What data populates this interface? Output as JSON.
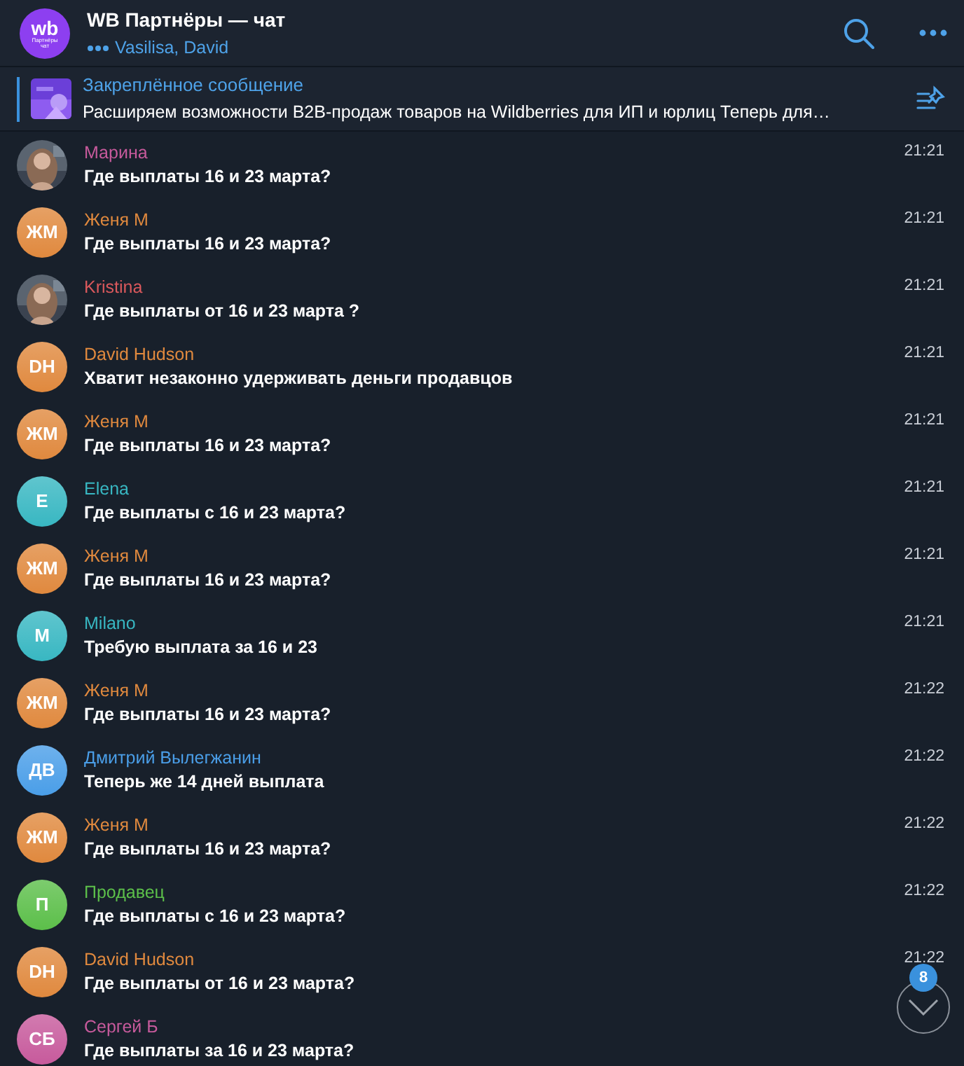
{
  "header": {
    "title": "WB Партнёры — чат",
    "logo_text": "wb",
    "logo_sub": "Партнёры чат",
    "typing": "Vasilisa, David"
  },
  "pinned": {
    "label": "Закреплённое сообщение",
    "text": "Расширяем возможности B2B-продаж товаров на Wildberries для ИП и юрлиц  Теперь для…"
  },
  "messages": [
    {
      "kind": "picture",
      "author": "Марина",
      "color": "#c75a9c",
      "text": "Где выплаты 16 и 23 марта?",
      "time": "21:21"
    },
    {
      "kind": "initials",
      "initials": "ЖМ",
      "author": "Женя М",
      "color": "#e0893e",
      "text": "Где выплаты 16 и 23 марта?",
      "time": "21:21"
    },
    {
      "kind": "picture",
      "author": "Kristina",
      "color": "#d9585c",
      "text": "Где выплаты от 16 и 23 марта ?",
      "time": "21:21"
    },
    {
      "kind": "initials",
      "initials": "DH",
      "author": "David Hudson",
      "color": "#e0893e",
      "text": "Хватит незаконно удерживать деньги продавцов",
      "time": "21:21"
    },
    {
      "kind": "initials",
      "initials": "ЖМ",
      "author": "Женя М",
      "color": "#e0893e",
      "text": "Где выплаты 16 и 23 марта?",
      "time": "21:21"
    },
    {
      "kind": "initials",
      "initials": "E",
      "author": "Elena",
      "color": "#38b7c2",
      "text": "Где выплаты с 16 и 23 марта?",
      "time": "21:21"
    },
    {
      "kind": "initials",
      "initials": "ЖМ",
      "author": "Женя М",
      "color": "#e0893e",
      "text": "Где выплаты 16 и 23 марта?",
      "time": "21:21"
    },
    {
      "kind": "initials",
      "initials": "M",
      "author": "Milano",
      "color": "#38b7c2",
      "text": "Требую выплата за 16 и 23",
      "time": "21:21"
    },
    {
      "kind": "initials",
      "initials": "ЖМ",
      "author": "Женя М",
      "color": "#e0893e",
      "text": "Где выплаты 16 и 23 марта?",
      "time": "21:22"
    },
    {
      "kind": "initials",
      "initials": "ДВ",
      "author": "Дмитрий Вылегжанин",
      "color": "#4a9ee8",
      "text": "Теперь же 14 дней выплата",
      "time": "21:22"
    },
    {
      "kind": "initials",
      "initials": "ЖМ",
      "author": "Женя М",
      "color": "#e0893e",
      "text": "Где выплаты 16 и 23 марта?",
      "time": "21:22"
    },
    {
      "kind": "initials",
      "initials": "П",
      "author": "Продавец",
      "color": "#5cbf4a",
      "text": "Где выплаты с 16 и 23 марта?",
      "time": "21:22"
    },
    {
      "kind": "initials",
      "initials": "DH",
      "author": "David Hudson",
      "color": "#e0893e",
      "text": "Где выплаты от 16 и 23 марта?",
      "time": "21:22"
    },
    {
      "kind": "initials",
      "initials": "СБ",
      "author": "Сергей Б",
      "color": "#c75a9c",
      "text": "Где выплаты за 16 и 23 марта?"
    }
  ],
  "scroll_button": {
    "badge": "8"
  }
}
